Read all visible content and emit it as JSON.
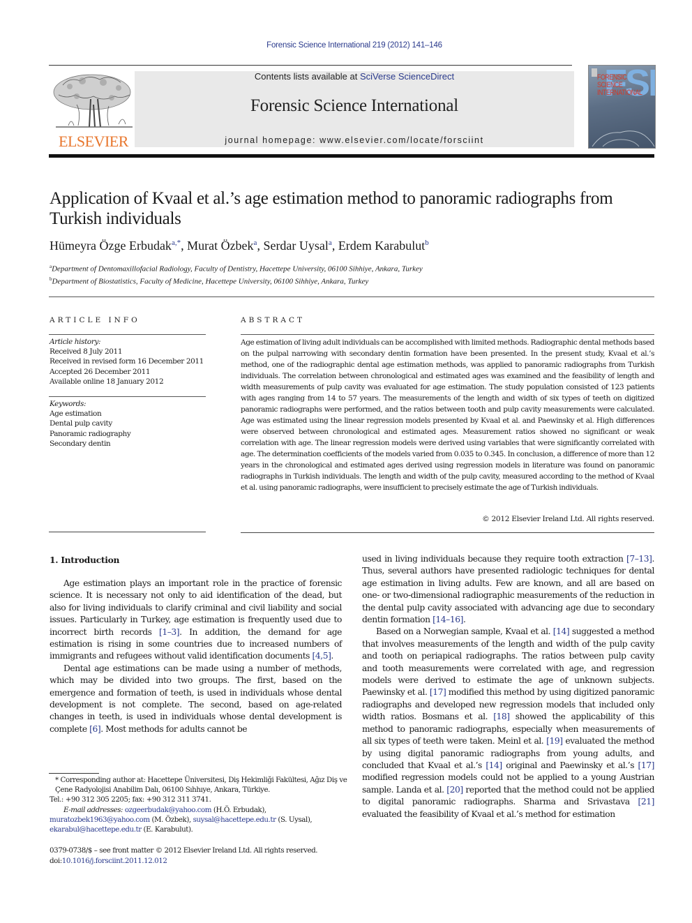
{
  "header": {
    "running_head": "Forensic Science International 219 (2012) 141–146",
    "contents_prefix": "Contents lists available at ",
    "contents_link": "SciVerse ScienceDirect",
    "journal_title": "Forensic Science International",
    "homepage_label": "journal homepage: www.elsevier.com/locate/forsciint",
    "publisher_logo_text": "ELSEVIER",
    "cover": {
      "big_letters": "FSI",
      "title_lines": [
        "FORENSIC",
        "SCIENCE",
        "INTERNATIONAL"
      ]
    },
    "colors": {
      "link": "#2a3a8c",
      "elsevier_orange": "#e8772e",
      "banner_bg": "#e9e9e9"
    }
  },
  "article": {
    "title": "Application of Kvaal et al.’s age estimation method to panoramic radiographs from Turkish individuals",
    "authors": [
      {
        "name": "Hümeyra Özge Erbudak",
        "marks": "a,*"
      },
      {
        "name": "Murat Özbek",
        "marks": "a"
      },
      {
        "name": "Serdar Uysal",
        "marks": "a"
      },
      {
        "name": "Erdem Karabulut",
        "marks": "b"
      }
    ],
    "affiliations": [
      {
        "mark": "a",
        "text": "Department of Dentomaxillofacial Radiology, Faculty of Dentistry, Hacettepe University, 06100 Sihhiye, Ankara, Turkey"
      },
      {
        "mark": "b",
        "text": "Department of Biostatistics, Faculty of Medicine, Hacettepe University, 06100 Sihhiye, Ankara, Turkey"
      }
    ]
  },
  "article_info": {
    "heading": "ARTICLE INFO",
    "history_label": "Article history:",
    "history": [
      "Received 8 July 2011",
      "Received in revised form 16 December 2011",
      "Accepted 26 December 2011",
      "Available online 18 January 2012"
    ],
    "keywords_label": "Keywords:",
    "keywords": [
      "Age estimation",
      "Dental pulp cavity",
      "Panoramic radiography",
      "Secondary dentin"
    ]
  },
  "abstract": {
    "heading": "ABSTRACT",
    "text": "Age estimation of living adult individuals can be accomplished with limited methods. Radiographic dental methods based on the pulpal narrowing with secondary dentin formation have been presented. In the present study, Kvaal et al.’s method, one of the radiographic dental age estimation methods, was applied to panoramic radiographs from Turkish individuals. The correlation between chronological and estimated ages was examined and the feasibility of length and width measurements of pulp cavity was evaluated for age estimation. The study population consisted of 123 patients with ages ranging from 14 to 57 years. The measurements of the length and width of six types of teeth on digitized panoramic radiographs were performed, and the ratios between tooth and pulp cavity measurements were calculated. Age was estimated using the linear regression models presented by Kvaal et al. and Paewinsky et al. High differences were observed between chronological and estimated ages. Measurement ratios showed no significant or weak correlation with age. The linear regression models were derived using variables that were significantly correlated with age. The determination coefficients of the models varied from 0.035 to 0.345. In conclusion, a difference of more than 12 years in the chronological and estimated ages derived using regression models in literature was found on panoramic radiographs in Turkish individuals. The length and width of the pulp cavity, measured according to the method of Kvaal et al. using panoramic radiographs, were insufficient to precisely estimate the age of Turkish individuals.",
    "copyright": "© 2012 Elsevier Ireland Ltd. All rights reserved."
  },
  "body": {
    "section_heading": "1.  Introduction",
    "left_paragraphs": [
      [
        {
          "t": "Age estimation plays an important role in the practice of forensic science. It is necessary not only to aid identification of the dead, but also for living individuals to clarify criminal and civil liability and social issues. Particularly in Turkey, age estimation is frequently used due to incorrect birth records "
        },
        {
          "ref": "[1–3]"
        },
        {
          "t": ". In addition, the demand for age estimation is rising in some countries due to increased numbers of immigrants and refugees without valid identification documents "
        },
        {
          "ref": "[4,5]"
        },
        {
          "t": "."
        }
      ],
      [
        {
          "t": "Dental age estimations can be made using a number of methods, which may be divided into two groups. The first, based on the emergence and formation of teeth, is used in individuals whose dental development is not complete. The second, based on age-related changes in teeth, is used in individuals whose dental development is complete "
        },
        {
          "ref": "[6]"
        },
        {
          "t": ". Most methods for adults cannot be"
        }
      ]
    ],
    "right_paragraphs": [
      [
        {
          "t": "used in living individuals because they require tooth extraction "
        },
        {
          "ref": "[7–13]"
        },
        {
          "t": ". Thus, several authors have presented radiologic techniques for dental age estimation in living adults. Few are known, and all are based on one- or two-dimensional radiographic measurements of the reduction in the dental pulp cavity associated with advancing age due to secondary dentin formation "
        },
        {
          "ref": "[14–16]"
        },
        {
          "t": "."
        }
      ],
      [
        {
          "t": "Based on a Norwegian sample, Kvaal et al. "
        },
        {
          "ref": "[14]"
        },
        {
          "t": " suggested a method that involves measurements of the length and width of the pulp cavity and tooth on periapical radiographs. The ratios between pulp cavity and tooth measurements were correlated with age, and regression models were derived to estimate the age of unknown subjects. Paewinsky et al. "
        },
        {
          "ref": "[17]"
        },
        {
          "t": " modified this method by using digitized panoramic radiographs and developed new regression models that included only width ratios. Bosmans et al. "
        },
        {
          "ref": "[18]"
        },
        {
          "t": " showed the applicability of this method to panoramic radiographs, especially when measurements of all six types of teeth were taken. Meinl et al. "
        },
        {
          "ref": "[19]"
        },
        {
          "t": " evaluated the method by using digital panoramic radiographs from young adults, and concluded that Kvaal et al.’s "
        },
        {
          "ref": "[14]"
        },
        {
          "t": " original and Paewinsky et al.’s "
        },
        {
          "ref": "[17]"
        },
        {
          "t": " modified regression models could not be applied to a young Austrian sample. Landa et al. "
        },
        {
          "ref": "[20]"
        },
        {
          "t": " reported that the method could not be applied to digital panoramic radiographs. Sharma and Srivastava "
        },
        {
          "ref": "[21]"
        },
        {
          "t": " evaluated the feasibility of Kvaal et al.’s method for estimation"
        }
      ]
    ]
  },
  "footnotes": {
    "corresponding": "* Corresponding author at: Hacettepe Üniversitesi, Diş Hekimliği Fakültesi, Ağız Diş ve Çene Radyolojisi Anabilim Dalı, 06100 Sıhhıye, Ankara, Türkiye.",
    "tel": "Tel.: +90 312 305 2205; fax: +90 312 311 3741.",
    "email_label": "E-mail addresses:",
    "emails": [
      {
        "address": "ozgeerbudak@yahoo.com",
        "who": "(H.Ö. Erbudak),"
      },
      {
        "address": "muratozbek1963@yahoo.com",
        "who": "(M. Özbek),"
      },
      {
        "address": "suysal@hacettepe.edu.tr",
        "who": "(S. Uysal),"
      },
      {
        "address": "ekarabul@hacettepe.edu.tr",
        "who": "(E. Karabulut)."
      }
    ],
    "front_matter": "0379-0738/$ – see front matter © 2012 Elsevier Ireland Ltd. All rights reserved.",
    "doi_prefix": "doi:",
    "doi": "10.1016/j.forsciint.2011.12.012"
  }
}
